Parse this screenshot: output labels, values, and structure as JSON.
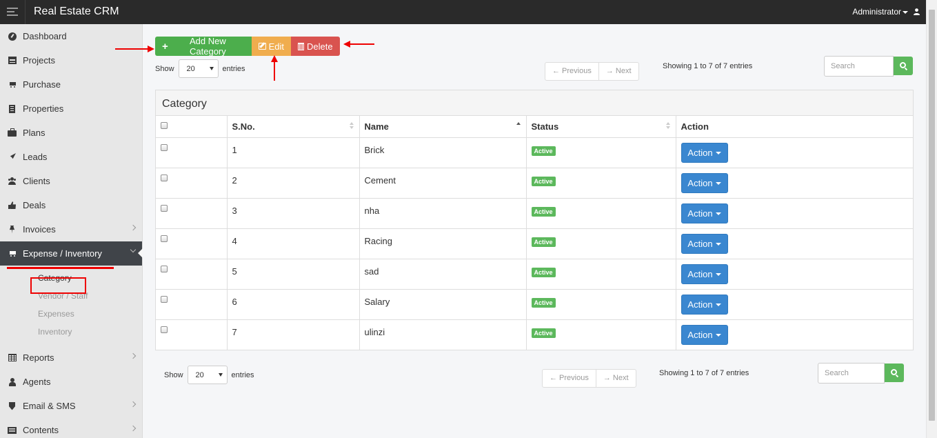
{
  "app": {
    "title": "Real Estate CRM",
    "user": "Administrator"
  },
  "sidebar": {
    "items": [
      {
        "label": "Dashboard",
        "icon": "dashboard-icon"
      },
      {
        "label": "Projects",
        "icon": "server-icon"
      },
      {
        "label": "Purchase",
        "icon": "cart-icon"
      },
      {
        "label": "Properties",
        "icon": "building-icon"
      },
      {
        "label": "Plans",
        "icon": "briefcase-icon"
      },
      {
        "label": "Leads",
        "icon": "rocket-icon"
      },
      {
        "label": "Clients",
        "icon": "users-icon"
      },
      {
        "label": "Deals",
        "icon": "thumbs-up-icon"
      },
      {
        "label": "Invoices",
        "icon": "pin-icon"
      },
      {
        "label": "Expense / Inventory",
        "icon": "cart-icon"
      },
      {
        "label": "Reports",
        "icon": "table-icon"
      },
      {
        "label": "Agents",
        "icon": "agent-icon"
      },
      {
        "label": "Email & SMS",
        "icon": "shield-icon"
      },
      {
        "label": "Contents",
        "icon": "newspaper-icon"
      }
    ],
    "submenu": [
      "Category",
      "Vendor / Staff",
      "Expenses",
      "Inventory"
    ]
  },
  "toolbar": {
    "add_label": "Add New Category",
    "edit_label": "Edit",
    "delete_label": "Delete"
  },
  "length": {
    "show": "Show",
    "value": "20",
    "entries": "entries"
  },
  "pager": {
    "previous": "← Previous",
    "next": "→ Next"
  },
  "info": "Showing 1 to 7 of 7 entries",
  "search": {
    "placeholder": "Search"
  },
  "panel": {
    "title": "Category"
  },
  "table": {
    "columns": [
      "S.No.",
      "Name",
      "Status",
      "Action"
    ],
    "sort_column": "Name",
    "rows": [
      {
        "sno": "1",
        "name": "Brick",
        "status": "Active"
      },
      {
        "sno": "2",
        "name": "Cement",
        "status": "Active"
      },
      {
        "sno": "3",
        "name": "nha",
        "status": "Active"
      },
      {
        "sno": "4",
        "name": "Racing",
        "status": "Active"
      },
      {
        "sno": "5",
        "name": "sad",
        "status": "Active"
      },
      {
        "sno": "6",
        "name": "Salary",
        "status": "Active"
      },
      {
        "sno": "7",
        "name": "ulinzi",
        "status": "Active"
      }
    ],
    "action_label": "Action"
  },
  "colors": {
    "topbar": "#2a2a2a",
    "sidebar_active": "#404449",
    "success": "#5cb85c",
    "warning": "#f0ad4e",
    "danger": "#d9534f",
    "primary": "#3a87d0",
    "annotation": "#ee0000"
  }
}
